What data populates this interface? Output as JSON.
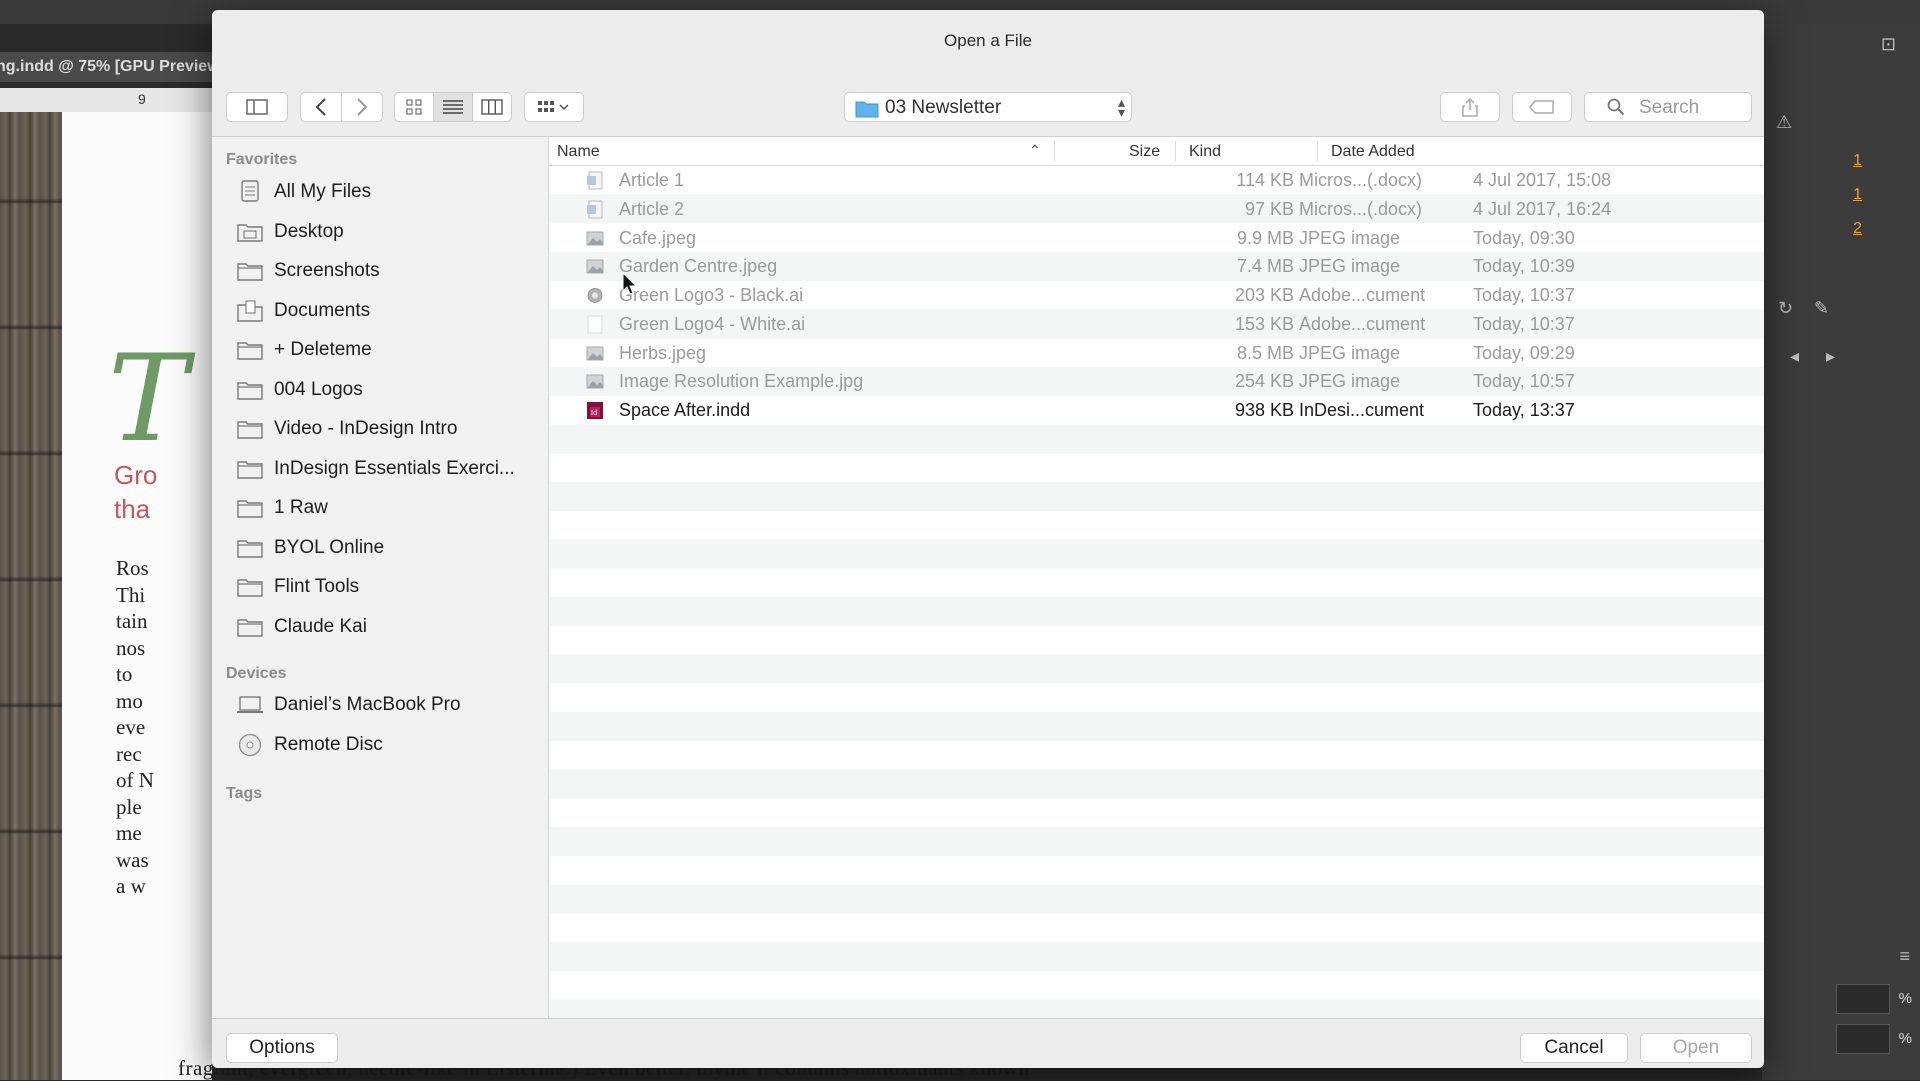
{
  "app": {
    "doc_tab": "ng.indd @ 75% [GPU Preview",
    "ruler_mark": "9",
    "heading_fragment": "T",
    "red_lines": [
      "Gro",
      "tha"
    ],
    "body_lines": [
      "Ros",
      "Thi",
      "tain",
      "nos",
      "to",
      "mo",
      "eve",
      "rec",
      "of N",
      "ple",
      "me",
      "was",
      "a w"
    ],
    "bottom_line": "fragrant, evergreen, needle-like   in Listerine.) Even better, thyme   it contains antioxidants known",
    "page_numbers": [
      "1",
      "1",
      "2"
    ],
    "pct": [
      "%",
      "%"
    ]
  },
  "dialog": {
    "title": "Open a File",
    "location": "03 Newsletter",
    "search_placeholder": "Search",
    "options_label": "Options",
    "cancel_label": "Cancel",
    "open_label": "Open"
  },
  "sidebar": {
    "favorites_header": "Favorites",
    "favorites": [
      {
        "label": "All My Files",
        "icon": "all-files-icon"
      },
      {
        "label": "Desktop",
        "icon": "desktop-folder-icon"
      },
      {
        "label": "Screenshots",
        "icon": "folder-icon"
      },
      {
        "label": "Documents",
        "icon": "documents-folder-icon"
      },
      {
        "label": "+ Deleteme",
        "icon": "folder-icon"
      },
      {
        "label": "004 Logos",
        "icon": "folder-icon"
      },
      {
        "label": "Video - InDesign Intro",
        "icon": "folder-icon"
      },
      {
        "label": "InDesign Essentials Exerci...",
        "icon": "folder-icon"
      },
      {
        "label": "1 Raw",
        "icon": "folder-icon"
      },
      {
        "label": "BYOL Online",
        "icon": "folder-icon"
      },
      {
        "label": "Flint Tools",
        "icon": "folder-icon"
      },
      {
        "label": "Claude Kai",
        "icon": "folder-icon"
      }
    ],
    "devices_header": "Devices",
    "devices": [
      {
        "label": "Daniel’s MacBook Pro",
        "icon": "laptop-icon"
      },
      {
        "label": "Remote Disc",
        "icon": "disc-icon"
      }
    ],
    "tags_header": "Tags"
  },
  "columns": {
    "name": "Name",
    "size": "Size",
    "kind": "Kind",
    "date": "Date Added"
  },
  "files": [
    {
      "name": "Article 1",
      "size": "114 KB",
      "kind": "Micros...(.docx)",
      "date": "4 Jul 2017, 15:08",
      "icon": "word-doc-icon",
      "enabled": false
    },
    {
      "name": "Article 2",
      "size": "97 KB",
      "kind": "Micros...(.docx)",
      "date": "4 Jul 2017, 16:24",
      "icon": "word-doc-icon",
      "enabled": false
    },
    {
      "name": "Cafe.jpeg",
      "size": "9.9 MB",
      "kind": "JPEG image",
      "date": "Today, 09:30",
      "icon": "image-file-icon",
      "enabled": false
    },
    {
      "name": "Garden Centre.jpeg",
      "size": "7.4 MB",
      "kind": "JPEG image",
      "date": "Today, 10:39",
      "icon": "image-file-icon",
      "enabled": false
    },
    {
      "name": "Green Logo3 - Black.ai",
      "size": "203 KB",
      "kind": "Adobe...cument",
      "date": "Today, 10:37",
      "icon": "illustrator-file-icon",
      "enabled": false
    },
    {
      "name": "Green Logo4 - White.ai",
      "size": "153 KB",
      "kind": "Adobe...cument",
      "date": "Today, 10:37",
      "icon": "blank-file-icon",
      "enabled": false
    },
    {
      "name": "Herbs.jpeg",
      "size": "8.5 MB",
      "kind": "JPEG image",
      "date": "Today, 09:29",
      "icon": "image-file-icon",
      "enabled": false
    },
    {
      "name": "Image Resolution Example.jpg",
      "size": "254 KB",
      "kind": "JPEG image",
      "date": "Today, 10:57",
      "icon": "image-file-icon",
      "enabled": false
    },
    {
      "name": "Space After.indd",
      "size": "938 KB",
      "kind": "InDesi...cument",
      "date": "Today, 13:37",
      "icon": "indesign-file-icon",
      "enabled": true
    }
  ]
}
